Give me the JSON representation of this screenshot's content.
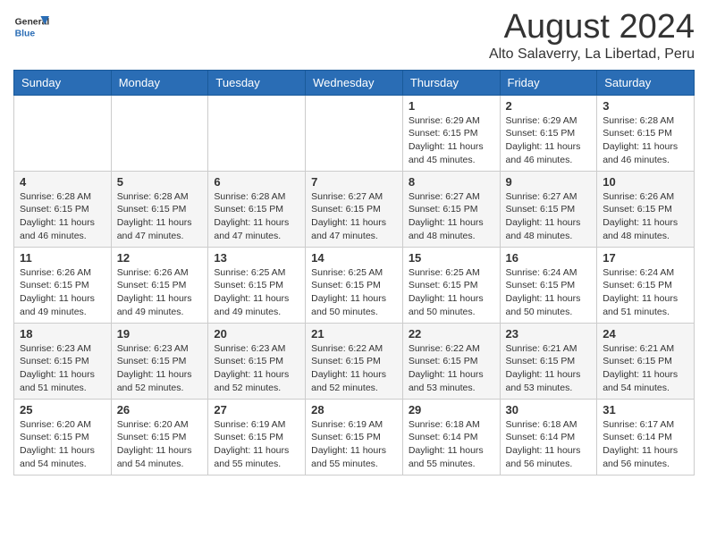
{
  "logo": {
    "general": "General",
    "blue": "Blue"
  },
  "title": "August 2024",
  "location": "Alto Salaverry, La Libertad, Peru",
  "weekdays": [
    "Sunday",
    "Monday",
    "Tuesday",
    "Wednesday",
    "Thursday",
    "Friday",
    "Saturday"
  ],
  "weeks": [
    [
      {
        "day": "",
        "info": ""
      },
      {
        "day": "",
        "info": ""
      },
      {
        "day": "",
        "info": ""
      },
      {
        "day": "",
        "info": ""
      },
      {
        "day": "1",
        "info": "Sunrise: 6:29 AM\nSunset: 6:15 PM\nDaylight: 11 hours\nand 45 minutes."
      },
      {
        "day": "2",
        "info": "Sunrise: 6:29 AM\nSunset: 6:15 PM\nDaylight: 11 hours\nand 46 minutes."
      },
      {
        "day": "3",
        "info": "Sunrise: 6:28 AM\nSunset: 6:15 PM\nDaylight: 11 hours\nand 46 minutes."
      }
    ],
    [
      {
        "day": "4",
        "info": "Sunrise: 6:28 AM\nSunset: 6:15 PM\nDaylight: 11 hours\nand 46 minutes."
      },
      {
        "day": "5",
        "info": "Sunrise: 6:28 AM\nSunset: 6:15 PM\nDaylight: 11 hours\nand 47 minutes."
      },
      {
        "day": "6",
        "info": "Sunrise: 6:28 AM\nSunset: 6:15 PM\nDaylight: 11 hours\nand 47 minutes."
      },
      {
        "day": "7",
        "info": "Sunrise: 6:27 AM\nSunset: 6:15 PM\nDaylight: 11 hours\nand 47 minutes."
      },
      {
        "day": "8",
        "info": "Sunrise: 6:27 AM\nSunset: 6:15 PM\nDaylight: 11 hours\nand 48 minutes."
      },
      {
        "day": "9",
        "info": "Sunrise: 6:27 AM\nSunset: 6:15 PM\nDaylight: 11 hours\nand 48 minutes."
      },
      {
        "day": "10",
        "info": "Sunrise: 6:26 AM\nSunset: 6:15 PM\nDaylight: 11 hours\nand 48 minutes."
      }
    ],
    [
      {
        "day": "11",
        "info": "Sunrise: 6:26 AM\nSunset: 6:15 PM\nDaylight: 11 hours\nand 49 minutes."
      },
      {
        "day": "12",
        "info": "Sunrise: 6:26 AM\nSunset: 6:15 PM\nDaylight: 11 hours\nand 49 minutes."
      },
      {
        "day": "13",
        "info": "Sunrise: 6:25 AM\nSunset: 6:15 PM\nDaylight: 11 hours\nand 49 minutes."
      },
      {
        "day": "14",
        "info": "Sunrise: 6:25 AM\nSunset: 6:15 PM\nDaylight: 11 hours\nand 50 minutes."
      },
      {
        "day": "15",
        "info": "Sunrise: 6:25 AM\nSunset: 6:15 PM\nDaylight: 11 hours\nand 50 minutes."
      },
      {
        "day": "16",
        "info": "Sunrise: 6:24 AM\nSunset: 6:15 PM\nDaylight: 11 hours\nand 50 minutes."
      },
      {
        "day": "17",
        "info": "Sunrise: 6:24 AM\nSunset: 6:15 PM\nDaylight: 11 hours\nand 51 minutes."
      }
    ],
    [
      {
        "day": "18",
        "info": "Sunrise: 6:23 AM\nSunset: 6:15 PM\nDaylight: 11 hours\nand 51 minutes."
      },
      {
        "day": "19",
        "info": "Sunrise: 6:23 AM\nSunset: 6:15 PM\nDaylight: 11 hours\nand 52 minutes."
      },
      {
        "day": "20",
        "info": "Sunrise: 6:23 AM\nSunset: 6:15 PM\nDaylight: 11 hours\nand 52 minutes."
      },
      {
        "day": "21",
        "info": "Sunrise: 6:22 AM\nSunset: 6:15 PM\nDaylight: 11 hours\nand 52 minutes."
      },
      {
        "day": "22",
        "info": "Sunrise: 6:22 AM\nSunset: 6:15 PM\nDaylight: 11 hours\nand 53 minutes."
      },
      {
        "day": "23",
        "info": "Sunrise: 6:21 AM\nSunset: 6:15 PM\nDaylight: 11 hours\nand 53 minutes."
      },
      {
        "day": "24",
        "info": "Sunrise: 6:21 AM\nSunset: 6:15 PM\nDaylight: 11 hours\nand 54 minutes."
      }
    ],
    [
      {
        "day": "25",
        "info": "Sunrise: 6:20 AM\nSunset: 6:15 PM\nDaylight: 11 hours\nand 54 minutes."
      },
      {
        "day": "26",
        "info": "Sunrise: 6:20 AM\nSunset: 6:15 PM\nDaylight: 11 hours\nand 54 minutes."
      },
      {
        "day": "27",
        "info": "Sunrise: 6:19 AM\nSunset: 6:15 PM\nDaylight: 11 hours\nand 55 minutes."
      },
      {
        "day": "28",
        "info": "Sunrise: 6:19 AM\nSunset: 6:15 PM\nDaylight: 11 hours\nand 55 minutes."
      },
      {
        "day": "29",
        "info": "Sunrise: 6:18 AM\nSunset: 6:14 PM\nDaylight: 11 hours\nand 55 minutes."
      },
      {
        "day": "30",
        "info": "Sunrise: 6:18 AM\nSunset: 6:14 PM\nDaylight: 11 hours\nand 56 minutes."
      },
      {
        "day": "31",
        "info": "Sunrise: 6:17 AM\nSunset: 6:14 PM\nDaylight: 11 hours\nand 56 minutes."
      }
    ]
  ]
}
